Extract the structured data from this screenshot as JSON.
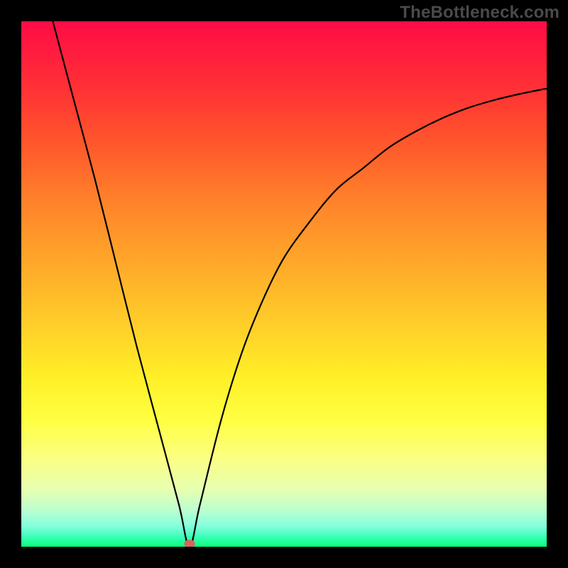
{
  "watermark": "TheBottleneck.com",
  "colors": {
    "frame_bg": "#000000",
    "watermark_text": "#4a4a4a",
    "curve": "#000000",
    "marker": "#d8645a",
    "gradient_stops": [
      "#ff0b46",
      "#ff1d3e",
      "#ff3534",
      "#ff5a2b",
      "#ff812b",
      "#ffa82a",
      "#ffcf29",
      "#fff028",
      "#ffff42",
      "#fbff82",
      "#e8ffb0",
      "#bcffcf",
      "#86ffdc",
      "#38ffb7",
      "#1fff9a",
      "#0bff82"
    ]
  },
  "chart_data": {
    "type": "line",
    "title": "",
    "xlabel": "",
    "ylabel": "",
    "xlim": [
      0,
      100
    ],
    "ylim": [
      0,
      100
    ],
    "grid": false,
    "legend": false,
    "description": "V-shaped bottleneck curve. y represents bottleneck severity (red=high, green=low). Curve reaches 0 at x≈32 (optimal point, marked), rises steeply and roughly linearly on the left, and rises with diminishing slope (concave) on the right.",
    "series": [
      {
        "name": "bottleneck-curve",
        "x": [
          6,
          10,
          14,
          18,
          22,
          26,
          30,
          32,
          34,
          38,
          42,
          46,
          50,
          55,
          60,
          65,
          70,
          75,
          80,
          85,
          90,
          95,
          100
        ],
        "values": [
          100,
          85,
          70,
          54,
          38,
          23,
          8,
          0,
          8,
          24,
          37,
          47,
          55,
          62,
          68,
          72,
          76,
          79,
          81.5,
          83.5,
          85,
          86.2,
          87.2
        ]
      }
    ],
    "marker": {
      "x": 32,
      "y": 0
    },
    "background_meaning": "vertical gradient maps y value 100→0 from red (severe bottleneck) to green (no bottleneck)"
  }
}
